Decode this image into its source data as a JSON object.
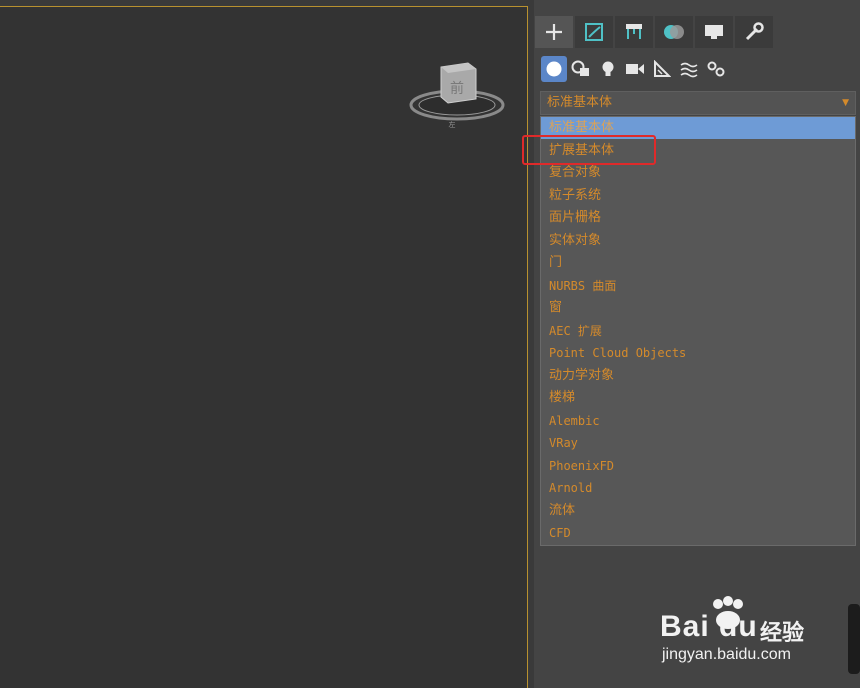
{
  "command_panel": {
    "tabs": [
      {
        "icon": "plus-icon",
        "active": true
      },
      {
        "icon": "modify-icon",
        "active": false
      },
      {
        "icon": "hierarchy-icon",
        "active": false
      },
      {
        "icon": "motion-icon",
        "active": false
      },
      {
        "icon": "display-icon",
        "active": false
      },
      {
        "icon": "wrench-icon",
        "active": false
      }
    ],
    "subtabs": [
      {
        "icon": "geometry-sphere-icon",
        "active": true
      },
      {
        "icon": "shapes-icon",
        "active": false
      },
      {
        "icon": "light-bulb-icon",
        "active": false
      },
      {
        "icon": "camera-icon",
        "active": false
      },
      {
        "icon": "helper-ruler-icon",
        "active": false
      },
      {
        "icon": "space-warp-icon",
        "active": false
      },
      {
        "icon": "systems-gear-icon",
        "active": false
      }
    ],
    "dropdown": {
      "selected": "标准基本体",
      "options": [
        {
          "label": "标准基本体",
          "selected": true
        },
        {
          "label": "扩展基本体",
          "highlighted": true
        },
        {
          "label": "复合对象"
        },
        {
          "label": "粒子系统"
        },
        {
          "label": "面片栅格"
        },
        {
          "label": "实体对象"
        },
        {
          "label": "门"
        },
        {
          "label": "NURBS 曲面",
          "mono": true
        },
        {
          "label": "窗"
        },
        {
          "label": "AEC 扩展",
          "mono": true
        },
        {
          "label": "Point Cloud Objects",
          "mono": true
        },
        {
          "label": "动力学对象"
        },
        {
          "label": "楼梯"
        },
        {
          "label": "Alembic",
          "mono": true
        },
        {
          "label": "VRay",
          "mono": true
        },
        {
          "label": "PhoenixFD",
          "mono": true
        },
        {
          "label": "Arnold",
          "mono": true
        },
        {
          "label": "流体"
        },
        {
          "label": "CFD",
          "mono": true
        }
      ]
    }
  },
  "viewport": {
    "viewcube": {
      "face_label": "前",
      "compass_label": "左"
    }
  },
  "watermark": {
    "brand": "Bai du",
    "suffix": "经验",
    "url": "jingyan.baidu.com"
  },
  "colors": {
    "accent_orange": "#d48a2b",
    "selection_blue": "#6e9bd6",
    "highlight_red": "#e02a2a",
    "viewport_border": "#b8912f"
  }
}
